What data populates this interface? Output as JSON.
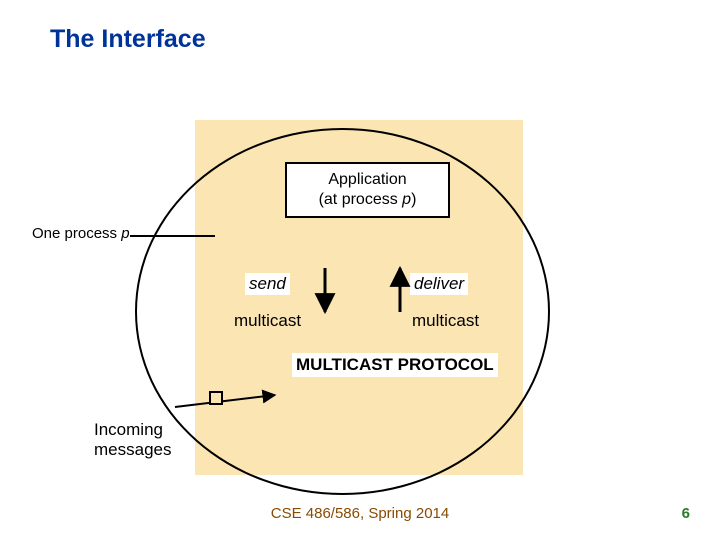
{
  "title": "The Interface",
  "app_box": {
    "line1": "Application",
    "line2_prefix": "(at process ",
    "line2_var": "p",
    "line2_suffix": ")"
  },
  "one_process": {
    "prefix": "One process ",
    "var": "p"
  },
  "labels": {
    "send": "send",
    "deliver": "deliver",
    "multicast_left": "multicast",
    "multicast_right": "multicast",
    "multicast_protocol": "MULTICAST PROTOCOL",
    "incoming_line1": "Incoming",
    "incoming_line2": "messages"
  },
  "footer": "CSE 486/586, Spring 2014",
  "page_number": "6"
}
